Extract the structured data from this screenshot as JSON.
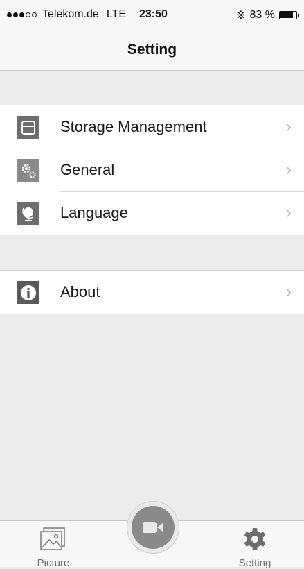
{
  "status_bar": {
    "carrier": "Telekom.de",
    "network": "LTE",
    "time": "23:50",
    "battery_text": "83 %",
    "battery_level": 0.83
  },
  "nav": {
    "title": "Setting"
  },
  "settings": {
    "items": [
      {
        "label": "Storage Management",
        "icon": "storage-icon"
      },
      {
        "label": "General",
        "icon": "gears-icon"
      },
      {
        "label": "Language",
        "icon": "globe-icon"
      }
    ],
    "about": {
      "label": "About",
      "icon": "info-icon"
    }
  },
  "tabbar": {
    "picture_label": "Picture",
    "setting_label": "Setting",
    "record_icon": "video-camera-icon"
  },
  "colors": {
    "background": "#ececec",
    "icon_tile": "#6d6d6d",
    "chevron": "#b3b3b3"
  }
}
